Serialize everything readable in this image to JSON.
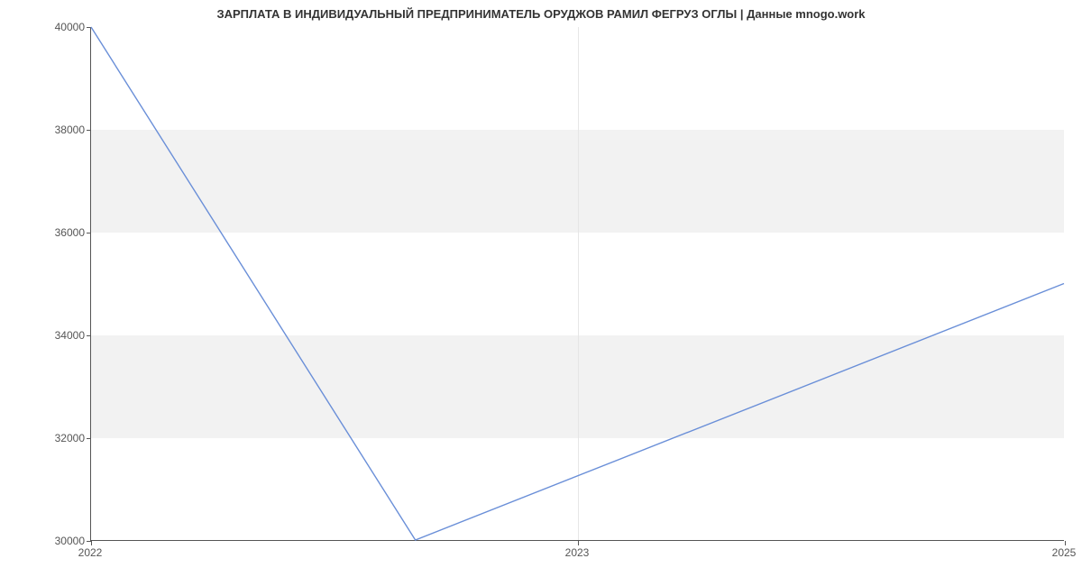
{
  "chart_data": {
    "type": "line",
    "title": "ЗАРПЛАТА В ИНДИВИДУАЛЬНЫЙ ПРЕДПРИНИМАТЕЛЬ ОРУДЖОВ РАМИЛ ФЕГРУЗ ОГЛЫ | Данные mnogo.work",
    "x": [
      2022,
      2023,
      2025
    ],
    "values": [
      40000,
      30000,
      35000
    ],
    "x_ticks": [
      2022,
      2023,
      2025
    ],
    "y_ticks": [
      30000,
      32000,
      34000,
      36000,
      38000,
      40000
    ],
    "xlim": [
      2022,
      2025
    ],
    "ylim": [
      30000,
      40000
    ],
    "xlabel": "",
    "ylabel": "",
    "line_color": "#6a8fd8"
  }
}
